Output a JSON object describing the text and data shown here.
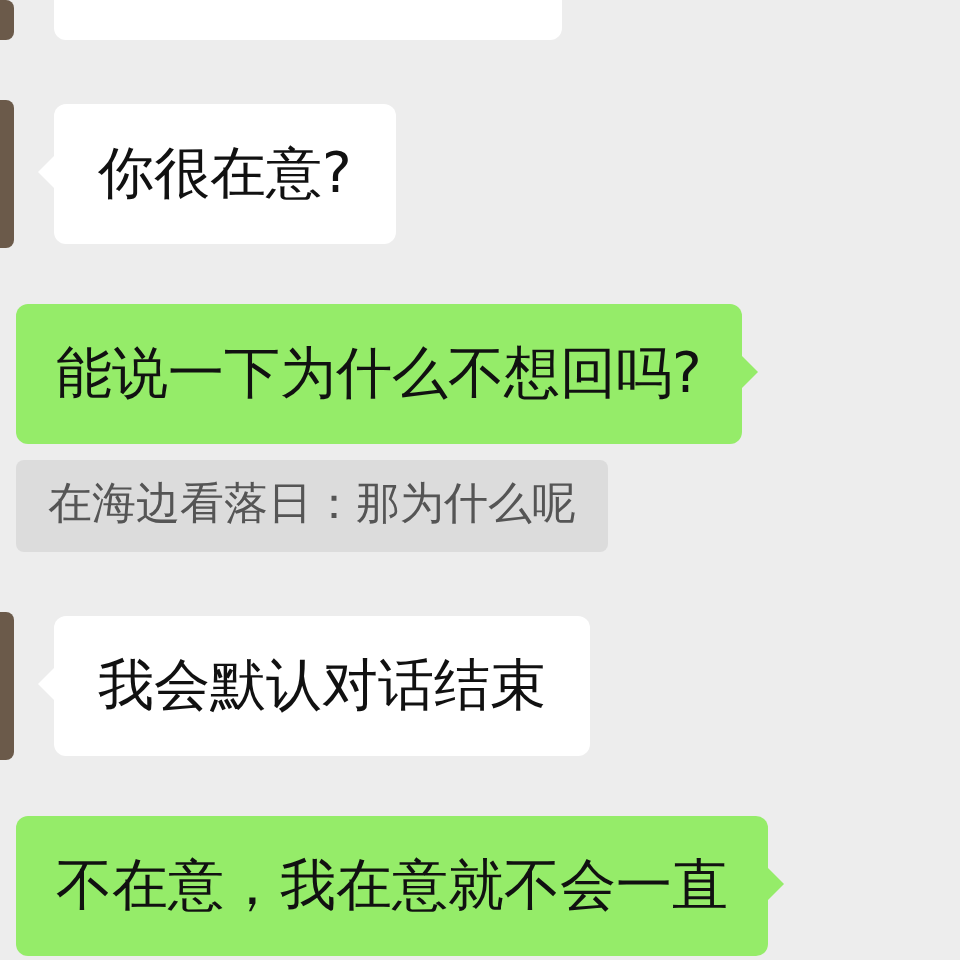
{
  "messages": [
    {
      "kind": "incoming",
      "text": "你很在意?"
    },
    {
      "kind": "outgoing",
      "text": "能说一下为什么不想回吗?"
    },
    {
      "kind": "quote",
      "text": "在海边看落日：那为什么呢"
    },
    {
      "kind": "incoming",
      "text": "我会默认对话结束"
    },
    {
      "kind": "outgoing",
      "text": "不在意，我在意就不会一直"
    }
  ]
}
